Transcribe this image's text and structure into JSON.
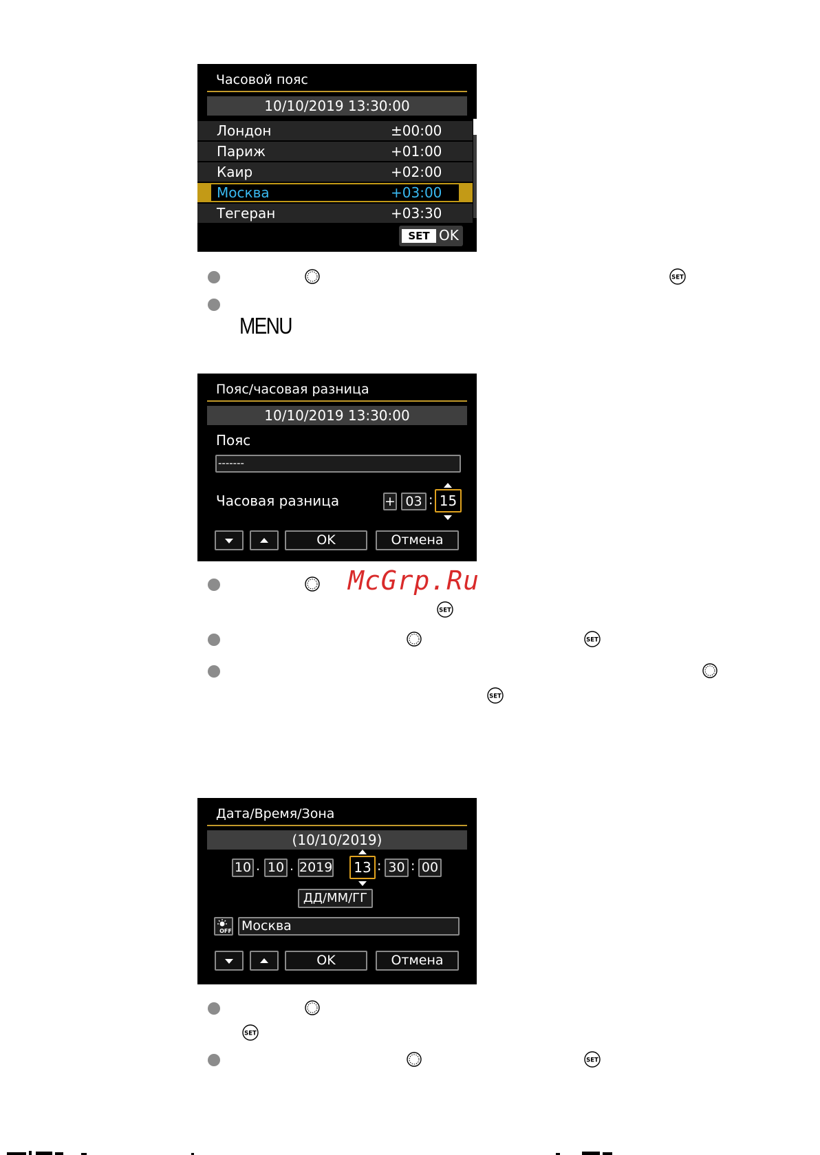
{
  "screen1": {
    "title": "Часовой пояс",
    "datetime": "10/10/2019 13:30:00",
    "zones": [
      {
        "city": "Лондон",
        "offset": "±00:00"
      },
      {
        "city": "Париж",
        "offset": "+01:00"
      },
      {
        "city": "Каир",
        "offset": "+02:00"
      },
      {
        "city": "Москва",
        "offset": "+03:00",
        "selected": true
      },
      {
        "city": "Тегеран",
        "offset": "+03:30"
      }
    ],
    "set_chip": "SET",
    "ok_label": "OK"
  },
  "screen2": {
    "title": "Пояс/часовая разница",
    "datetime": "10/10/2019 13:30:00",
    "zone_label": "Пояс",
    "zone_value": "-------",
    "diff_label": "Часовая разница",
    "sign": "+",
    "hours": "03",
    "colon": ":",
    "minutes": "15",
    "ok": "OK",
    "cancel": "Отмена"
  },
  "screen3": {
    "title": "Дата/Время/Зона",
    "date_header": "(10/10/2019)",
    "day": "10",
    "month": "10",
    "year": "2019",
    "hour": "13",
    "minute": "30",
    "second": "00",
    "dot": ".",
    "colon": ":",
    "format": "ДД/ММ/ГГ",
    "dst_icon_label": "OFF",
    "zone": "Москва",
    "ok": "OK",
    "cancel": "Отмена"
  },
  "page": {
    "menu_label": "MENU",
    "watermark": "McGrp.Ru"
  },
  "colors": {
    "accent_gold": "#c39a16",
    "selected_text": "#39b8f0",
    "watermark": "#d92a2a"
  }
}
